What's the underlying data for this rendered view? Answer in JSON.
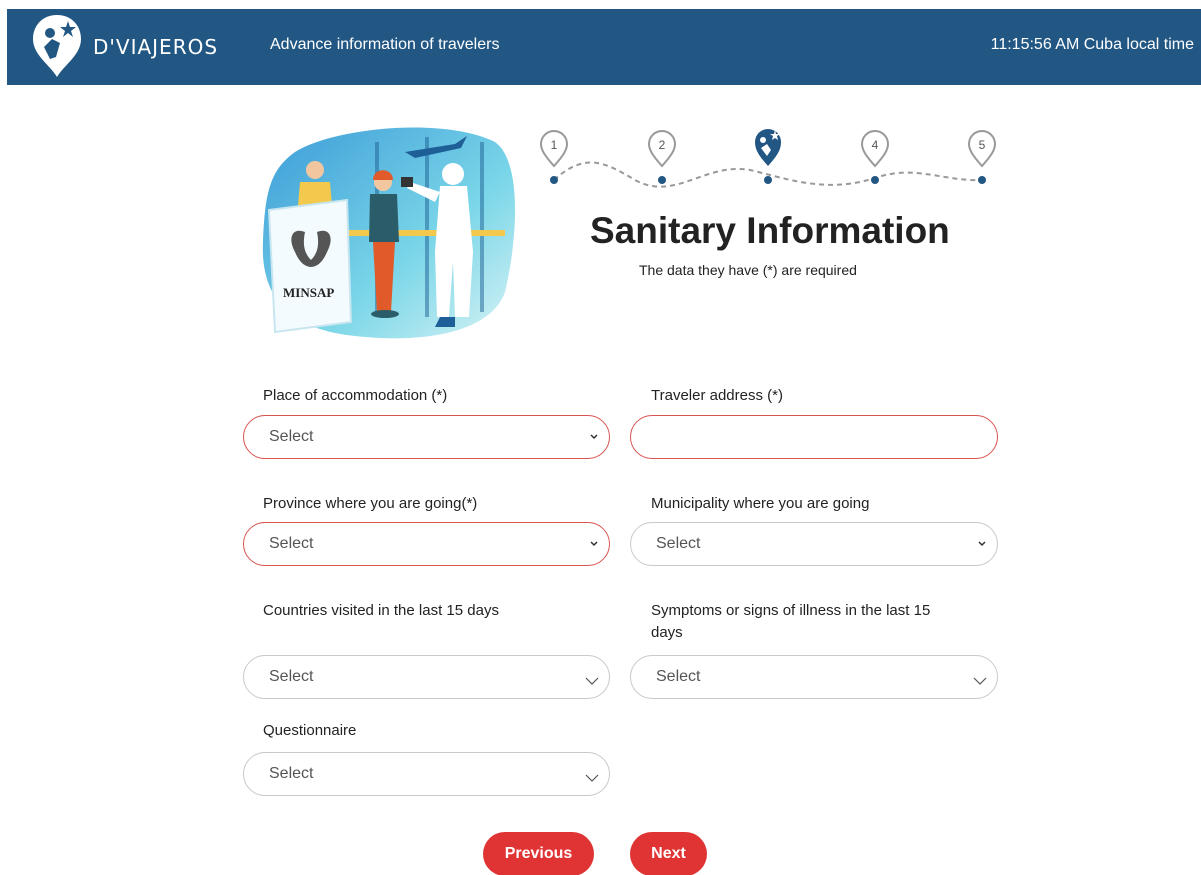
{
  "header": {
    "brand": "D'VIAJEROS",
    "subtitle": "Advance information of travelers",
    "clock": "11:15:56 AM Cuba local time"
  },
  "hero": {
    "sign_text": "MINSAP"
  },
  "stepper": {
    "steps": [
      "1",
      "2",
      "3",
      "4",
      "5"
    ],
    "current": 3
  },
  "form": {
    "title": "Sanitary Information",
    "hint": "The data they have (*) are required",
    "accommodation": {
      "label": "Place of accommodation (*)",
      "value": "Select"
    },
    "address": {
      "label": "Traveler address (*)",
      "value": ""
    },
    "province": {
      "label": "Province where you are going(*)",
      "value": "Select"
    },
    "municipality": {
      "label": "Municipality where you are going",
      "value": "Select"
    },
    "countries": {
      "label": "Countries visited in the last 15 days",
      "value": "Select"
    },
    "symptoms": {
      "label_line1": "Symptoms or signs of illness in the last 15",
      "label_line2": "days",
      "value": "Select"
    },
    "questionnaire": {
      "label": "Questionnaire",
      "value": "Select"
    }
  },
  "buttons": {
    "previous": "Previous",
    "next": "Next"
  },
  "colors": {
    "header_bg": "#225784",
    "button_bg": "#e03333",
    "invalid_border": "#d9534f",
    "step_dot": "#225784"
  }
}
